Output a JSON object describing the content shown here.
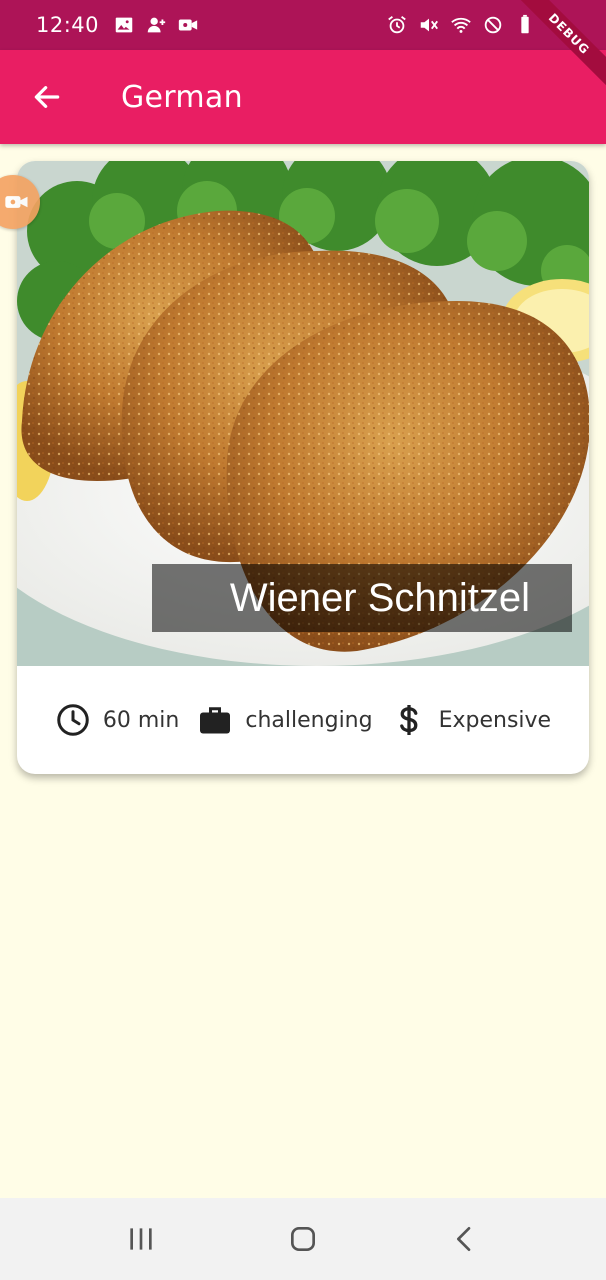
{
  "status_bar": {
    "time": "12:40",
    "left_icons": [
      "gallery-icon",
      "add-contact-icon",
      "video-camera-icon"
    ],
    "right_icons": [
      "alarm-icon",
      "mute-icon",
      "wifi-icon",
      "do-not-disturb-icon",
      "battery-icon"
    ]
  },
  "debug_banner": "DEBUG",
  "app_bar": {
    "back_icon": "arrow-back-icon",
    "title": "German"
  },
  "meal": {
    "title": "Wiener Schnitzel",
    "duration": "60 min",
    "complexity": "challenging",
    "affordability": "Expensive",
    "icons": {
      "duration": "clock-icon",
      "complexity": "briefcase-icon",
      "affordability": "dollar-icon"
    }
  },
  "nav_bar": {
    "buttons": [
      "recents-icon",
      "home-icon",
      "back-icon"
    ]
  },
  "colors": {
    "status_bar": "#ad1457",
    "app_bar": "#e91e63",
    "background": "#fffde7",
    "card": "#ffffff",
    "title_overlay": "rgba(0,0,0,0.54)",
    "nav_bar": "#f2f2f2"
  }
}
